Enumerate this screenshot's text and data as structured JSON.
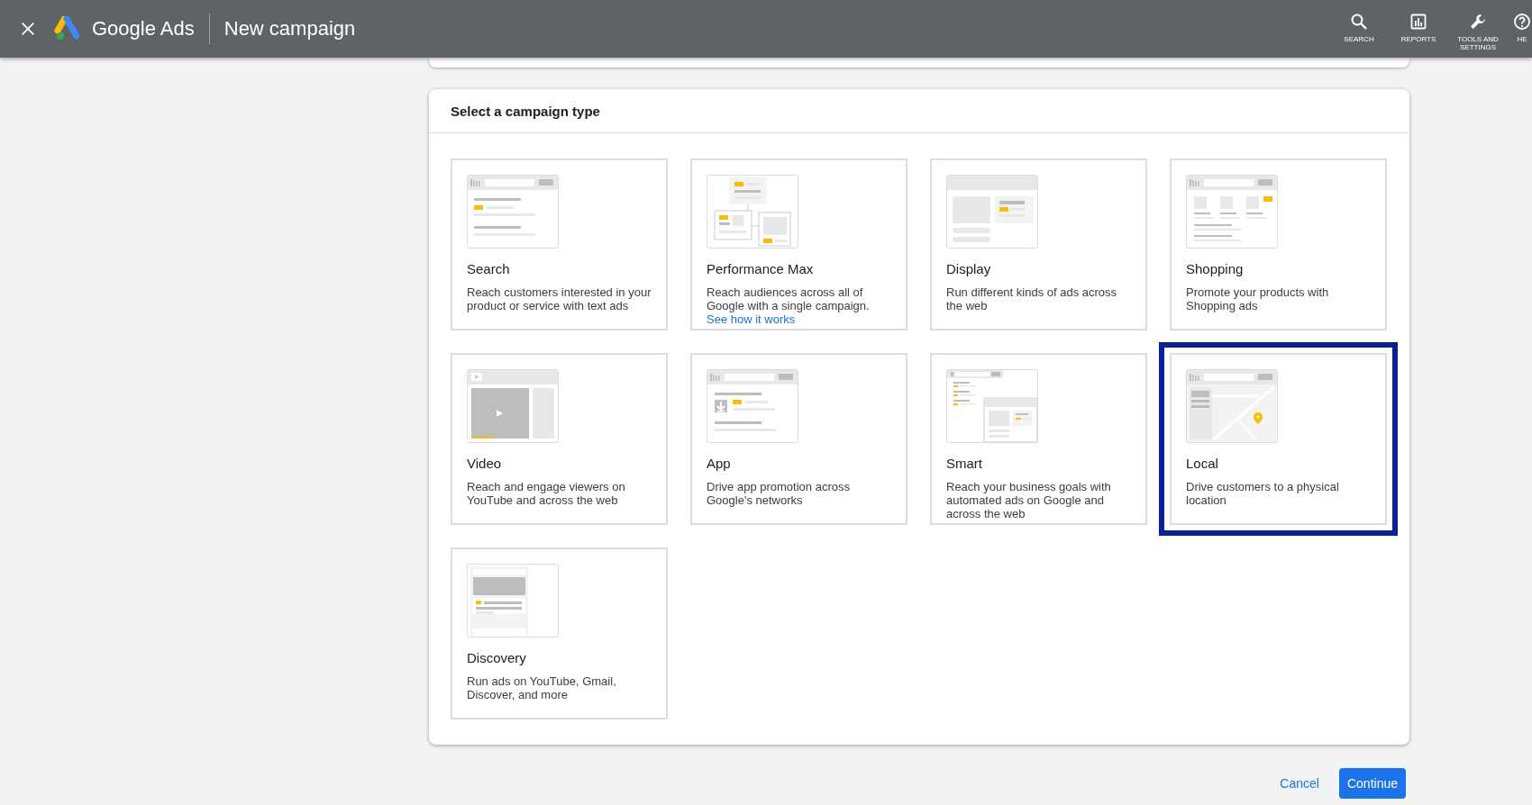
{
  "top_bar": {
    "brand": "Google Ads",
    "title": "New campaign",
    "nav": [
      {
        "kind": "search",
        "label": "SEARCH"
      },
      {
        "kind": "reports",
        "label": "REPORTS"
      },
      {
        "kind": "tools",
        "label": "TOOLS AND SETTINGS"
      },
      {
        "kind": "help",
        "label": "HE"
      }
    ]
  },
  "panel": {
    "title": "Select a campaign type",
    "cards": [
      {
        "kind": "search",
        "title": "Search",
        "description": "Reach customers interested in your product or service with text ads",
        "selected": false
      },
      {
        "kind": "pmax",
        "title": "Performance Max",
        "description": "Reach audiences across all of Google with a single campaign.",
        "link": "See how it works",
        "selected": false
      },
      {
        "kind": "display",
        "title": "Display",
        "description": "Run different kinds of ads across the web",
        "selected": false
      },
      {
        "kind": "shopping",
        "title": "Shopping",
        "description": "Promote your products with Shopping ads",
        "selected": false
      },
      {
        "kind": "video",
        "title": "Video",
        "description": "Reach and engage viewers on YouTube and across the web",
        "selected": false
      },
      {
        "kind": "app",
        "title": "App",
        "description": "Drive app promotion across Google's networks",
        "selected": false
      },
      {
        "kind": "smart",
        "title": "Smart",
        "description": "Reach your business goals with automated ads on Google and across the web",
        "selected": false
      },
      {
        "kind": "local",
        "title": "Local",
        "description": "Drive customers to a physical location",
        "selected": true
      },
      {
        "kind": "discovery",
        "title": "Discovery",
        "description": "Run ads on YouTube, Gmail, Discover, and more",
        "selected": false
      }
    ]
  },
  "actions": {
    "cancel": "Cancel",
    "continue": "Continue"
  }
}
